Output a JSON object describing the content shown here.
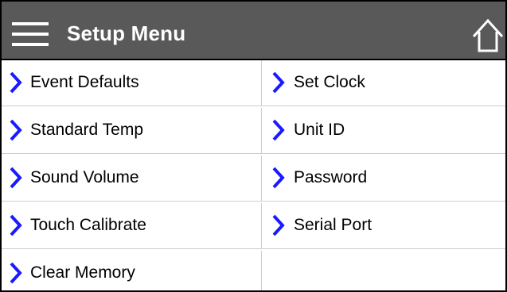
{
  "header": {
    "title": "Setup Menu",
    "background_color": "#595959",
    "menu_icon": "hamburger-icon",
    "home_icon": "home-icon"
  },
  "accent_color": "#1a1aff",
  "menu": {
    "left": [
      {
        "label": "Event Defaults"
      },
      {
        "label": "Standard Temp"
      },
      {
        "label": "Sound Volume"
      },
      {
        "label": "Touch Calibrate"
      },
      {
        "label": "Clear Memory"
      }
    ],
    "right": [
      {
        "label": "Set Clock"
      },
      {
        "label": "Unit ID"
      },
      {
        "label": "Password"
      },
      {
        "label": "Serial Port"
      }
    ]
  }
}
